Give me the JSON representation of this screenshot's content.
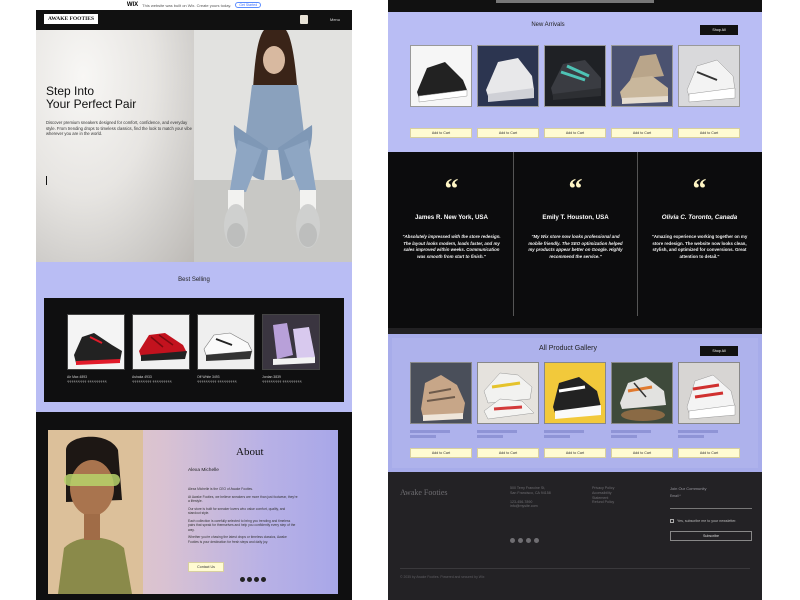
{
  "wixbar": {
    "brand": "WIX",
    "text": "This website was built on Wix. Create yours today.",
    "upgrade": "Get Started"
  },
  "nav": {
    "logo": "AWAKE FOOTIES",
    "menu": "Menu"
  },
  "hero": {
    "title_line1": "Step Into",
    "title_line2": "Your Perfect Pair",
    "text": "Discover premium sneakers designed for comfort, confidence, and everyday style. From trending drops to timeless classics, find the look to match your vibe wherever you are in the world."
  },
  "best_selling": {
    "title": "Best Selling",
    "products": [
      {
        "name": "Air Max 4893",
        "price": "₹₹₹₹₹₹₹₹₹ ₹₹₹₹₹₹₹₹₹"
      },
      {
        "name": "Ashaka 4933",
        "price": "₹₹₹₹₹₹₹₹₹ ₹₹₹₹₹₹₹₹₹"
      },
      {
        "name": "Off White 3493",
        "price": "₹₹₹₹₹₹₹₹₹ ₹₹₹₹₹₹₹₹₹"
      },
      {
        "name": "Jordan 3839",
        "price": "₹₹₹₹₹₹₹₹₹ ₹₹₹₹₹₹₹₹₹"
      }
    ]
  },
  "about": {
    "title": "About",
    "name": "Alexa Michelle",
    "p1": "Alexa Michelle is the CEO of Awake Footies.",
    "p2": "At Awake Footies, we believe sneakers are more than just footwear, they're a lifestyle.",
    "p3": "Our store is built for sneaker lovers who value comfort, quality, and standout style.",
    "p4": "Each collection is carefully selected to bring you trending and timeless pairs that speak for themselves and help you confidently every step of the way.",
    "p5": "Whether you're chasing the latest drops or timeless classics, Awake Footies is your destination for fresh steps and daily joy.",
    "contact": "Contact Us"
  },
  "new_arrivals": {
    "title": "New Arrivals",
    "shop_all": "Shop All",
    "add_to_cart": "Add to Cart"
  },
  "testimonials": [
    {
      "name": "James R. New York, USA",
      "quote": "\"Absolutely impressed with the store redesign. The layout looks modern, loads faster, and my sales improved within weeks. Communication was smooth from start to finish.\""
    },
    {
      "name": "Emily T.  Houston, USA",
      "quote": "\"My Wix store now looks professional and mobile friendly. The SEO optimization helped my products appear better on Google. Highly recommend the service.\""
    },
    {
      "name": "Olivia C. Toronto, Canada",
      "quote": "\"Amazing experience working together on my store redesign. The website now looks clean, stylish, and optimized for conversions. Great attention to detail.\""
    }
  ],
  "gallery": {
    "title": "All Product Gallery",
    "shop_all": "Shop All",
    "add_to_cart": "Add to Cart"
  },
  "footer": {
    "logo": "Awake Footies",
    "col1": [
      "500 Terry Francine St,",
      "San Francisco, CA 94158",
      "",
      "123-456-7890",
      "info@mysite.com"
    ],
    "col2": [
      "Privacy Policy",
      "Accessibility",
      "Statement",
      "Refund Policy"
    ],
    "join": "Join Our Community",
    "email_label": "Email *",
    "checkbox": "Yes, subscribe me to your newsletter.",
    "subscribe": "Subscribe",
    "copyright": "© 2035 by Awake Footies. Powered and secured by Wix"
  },
  "colors": {
    "lavender": "#b9bdf4",
    "black": "#0f0f10",
    "cream": "#fffbd2",
    "quote": "#fff5c4"
  }
}
